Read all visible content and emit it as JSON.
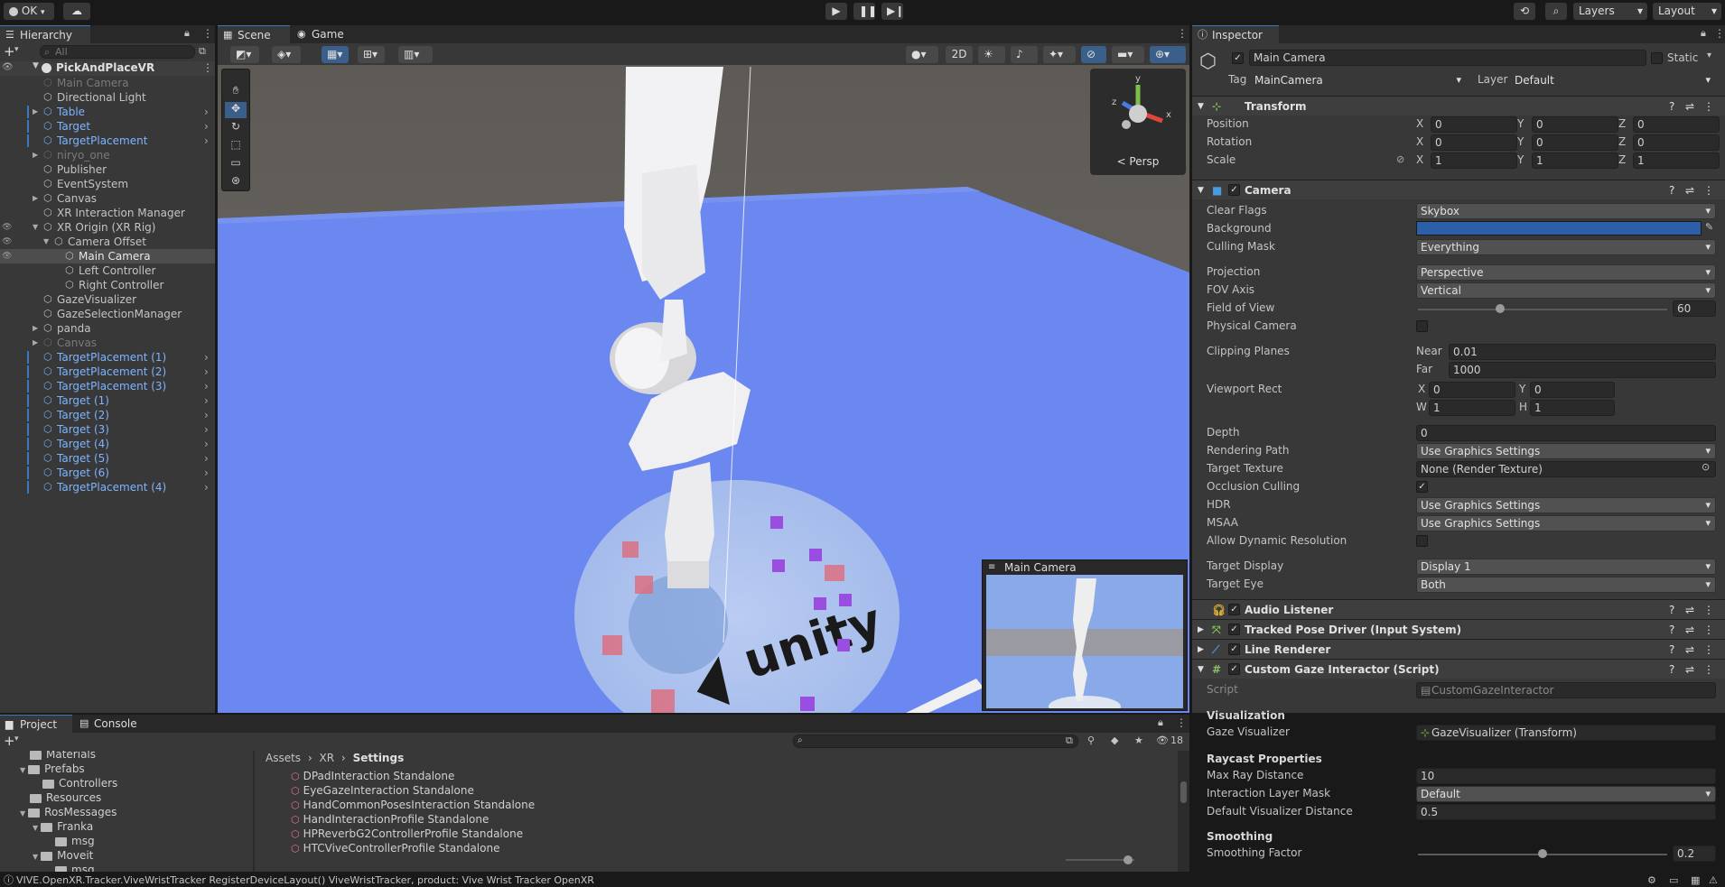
{
  "toolbar": {
    "account_label": "OK",
    "layers_label": "Layers",
    "layout_label": "Layout"
  },
  "hierarchy": {
    "tab_label": "Hierarchy",
    "search_placeholder": "All",
    "scene_name": "PickAndPlaceVR",
    "items": [
      {
        "label": "Main Camera",
        "style": "dim",
        "indent": 0,
        "arrow": false,
        "prefab": false
      },
      {
        "label": "Directional Light",
        "style": "normal",
        "indent": 0,
        "arrow": false,
        "prefab": false
      },
      {
        "label": "Table",
        "style": "prefab",
        "indent": 0,
        "arrow": true,
        "prefab": true
      },
      {
        "label": "Target",
        "style": "prefab",
        "indent": 0,
        "arrow": false,
        "prefab": true
      },
      {
        "label": "TargetPlacement",
        "style": "prefab",
        "indent": 0,
        "arrow": false,
        "prefab": true
      },
      {
        "label": "niryo_one",
        "style": "dim",
        "indent": 0,
        "arrow": true,
        "prefab": false
      },
      {
        "label": "Publisher",
        "style": "normal",
        "indent": 0,
        "arrow": false,
        "prefab": false
      },
      {
        "label": "EventSystem",
        "style": "normal",
        "indent": 0,
        "arrow": false,
        "prefab": false
      },
      {
        "label": "Canvas",
        "style": "normal",
        "indent": 0,
        "arrow": true,
        "prefab": false
      },
      {
        "label": "XR Interaction Manager",
        "style": "normal",
        "indent": 0,
        "arrow": false,
        "prefab": false
      },
      {
        "label": "XR Origin (XR Rig)",
        "style": "normal",
        "indent": 0,
        "arrow": true,
        "prefab": false
      },
      {
        "label": "Camera Offset",
        "style": "normal",
        "indent": 1,
        "arrow": true,
        "prefab": false
      },
      {
        "label": "Main Camera",
        "style": "selected",
        "indent": 2,
        "arrow": false,
        "prefab": false
      },
      {
        "label": "Left Controller",
        "style": "normal",
        "indent": 2,
        "arrow": false,
        "prefab": false
      },
      {
        "label": "Right Controller",
        "style": "normal",
        "indent": 2,
        "arrow": false,
        "prefab": false
      },
      {
        "label": "GazeVisualizer",
        "style": "normal",
        "indent": 0,
        "arrow": false,
        "prefab": false
      },
      {
        "label": "GazeSelectionManager",
        "style": "normal",
        "indent": 0,
        "arrow": false,
        "prefab": false
      },
      {
        "label": "panda",
        "style": "normal",
        "indent": 0,
        "arrow": true,
        "prefab": false
      },
      {
        "label": "Canvas",
        "style": "dim",
        "indent": 0,
        "arrow": true,
        "prefab": false
      },
      {
        "label": "TargetPlacement (1)",
        "style": "prefab",
        "indent": 0,
        "arrow": false,
        "prefab": true
      },
      {
        "label": "TargetPlacement (2)",
        "style": "prefab",
        "indent": 0,
        "arrow": false,
        "prefab": true
      },
      {
        "label": "TargetPlacement (3)",
        "style": "prefab",
        "indent": 0,
        "arrow": false,
        "prefab": true
      },
      {
        "label": "Target (1)",
        "style": "prefab",
        "indent": 0,
        "arrow": false,
        "prefab": true
      },
      {
        "label": "Target (2)",
        "style": "prefab",
        "indent": 0,
        "arrow": false,
        "prefab": true
      },
      {
        "label": "Target (3)",
        "style": "prefab",
        "indent": 0,
        "arrow": false,
        "prefab": true
      },
      {
        "label": "Target (4)",
        "style": "prefab",
        "indent": 0,
        "arrow": false,
        "prefab": true
      },
      {
        "label": "Target (5)",
        "style": "prefab",
        "indent": 0,
        "arrow": false,
        "prefab": true
      },
      {
        "label": "Target (6)",
        "style": "prefab",
        "indent": 0,
        "arrow": false,
        "prefab": true
      },
      {
        "label": "TargetPlacement (4)",
        "style": "prefab",
        "indent": 0,
        "arrow": false,
        "prefab": true
      }
    ]
  },
  "scene": {
    "tab_scene": "Scene",
    "tab_game": "Game",
    "btn_2d": "2D",
    "persp_label": "< Persp",
    "gizmo_y": "y",
    "gizmo_x": "x",
    "gizmo_z": "z",
    "preview_title": "Main Camera",
    "logo_text": "unity"
  },
  "inspector": {
    "tab_label": "Inspector",
    "object_name": "Main Camera",
    "static_label": "Static",
    "tag_label": "Tag",
    "tag_value": "MainCamera",
    "layer_label": "Layer",
    "layer_value": "Default",
    "transform": {
      "title": "Transform",
      "position_label": "Position",
      "position": [
        "0",
        "0",
        "0"
      ],
      "rotation_label": "Rotation",
      "rotation": [
        "0",
        "0",
        "0"
      ],
      "scale_label": "Scale",
      "scale": [
        "1",
        "1",
        "1"
      ]
    },
    "camera": {
      "title": "Camera",
      "clear_flags_label": "Clear Flags",
      "clear_flags": "Skybox",
      "background_label": "Background",
      "background_color": "#2d5fa8",
      "culling_mask_label": "Culling Mask",
      "culling_mask": "Everything",
      "projection_label": "Projection",
      "projection": "Perspective",
      "fov_axis_label": "FOV Axis",
      "fov_axis": "Vertical",
      "fov_label": "Field of View",
      "fov": "60",
      "fov_fraction": 0.33,
      "physical_label": "Physical Camera",
      "clipping_label": "Clipping Planes",
      "near_label": "Near",
      "near": "0.01",
      "far_label": "Far",
      "far": "1000",
      "viewport_label": "Viewport Rect",
      "vp_x": "0",
      "vp_y": "0",
      "vp_w": "1",
      "vp_h": "1",
      "depth_label": "Depth",
      "depth": "0",
      "rendering_path_label": "Rendering Path",
      "rendering_path": "Use Graphics Settings",
      "target_texture_label": "Target Texture",
      "target_texture": "None (Render Texture)",
      "occlusion_label": "Occlusion Culling",
      "hdr_label": "HDR",
      "hdr": "Use Graphics Settings",
      "msaa_label": "MSAA",
      "msaa": "Use Graphics Settings",
      "dynres_label": "Allow Dynamic Resolution",
      "target_display_label": "Target Display",
      "target_display": "Display 1",
      "target_eye_label": "Target Eye",
      "target_eye": "Both"
    },
    "audio_listener": "Audio Listener",
    "tracked_pose": "Tracked Pose Driver (Input System)",
    "line_renderer": "Line Renderer",
    "gaze_script": {
      "title": "Custom Gaze Interactor (Script)",
      "script_label": "Script",
      "script_value": "CustomGazeInteractor",
      "visualization_header": "Visualization",
      "gaze_visualizer_label": "Gaze Visualizer",
      "gaze_visualizer": "GazeVisualizer (Transform)",
      "raycast_header": "Raycast Properties",
      "max_ray_label": "Max Ray Distance",
      "max_ray": "10",
      "layer_mask_label": "Interaction Layer Mask",
      "layer_mask": "Default",
      "default_dist_label": "Default Visualizer Distance",
      "default_dist": "0.5",
      "smoothing_header": "Smoothing",
      "smoothing_factor_label": "Smoothing Factor",
      "smoothing_factor": "0.2",
      "smoothing_fraction": 0.5
    }
  },
  "project": {
    "tab_project": "Project",
    "tab_console": "Console",
    "breadcrumb": [
      "Assets",
      "XR",
      "Settings"
    ],
    "hidden_count": "18",
    "tree": [
      {
        "label": "Materials",
        "indent": 1,
        "arrow": false
      },
      {
        "label": "Prefabs",
        "indent": 1,
        "arrow": true
      },
      {
        "label": "Controllers",
        "indent": 2,
        "arrow": false
      },
      {
        "label": "Resources",
        "indent": 1,
        "arrow": false
      },
      {
        "label": "RosMessages",
        "indent": 1,
        "arrow": true
      },
      {
        "label": "Franka",
        "indent": 2,
        "arrow": true
      },
      {
        "label": "msg",
        "indent": 3,
        "arrow": false
      },
      {
        "label": "Moveit",
        "indent": 2,
        "arrow": true
      },
      {
        "label": "msg",
        "indent": 3,
        "arrow": false
      }
    ],
    "files": [
      "DPadInteraction Standalone",
      "EyeGazeInteraction Standalone",
      "HandCommonPosesInteraction Standalone",
      "HandInteractionProfile Standalone",
      "HPReverbG2ControllerProfile Standalone",
      "HTCViveControllerProfile Standalone"
    ]
  },
  "status_bar": {
    "message": "VIVE.OpenXR.Tracker.ViveWristTracker  RegisterDeviceLayout() ViveWristTracker, product: Vive Wrist Tracker OpenXR"
  }
}
